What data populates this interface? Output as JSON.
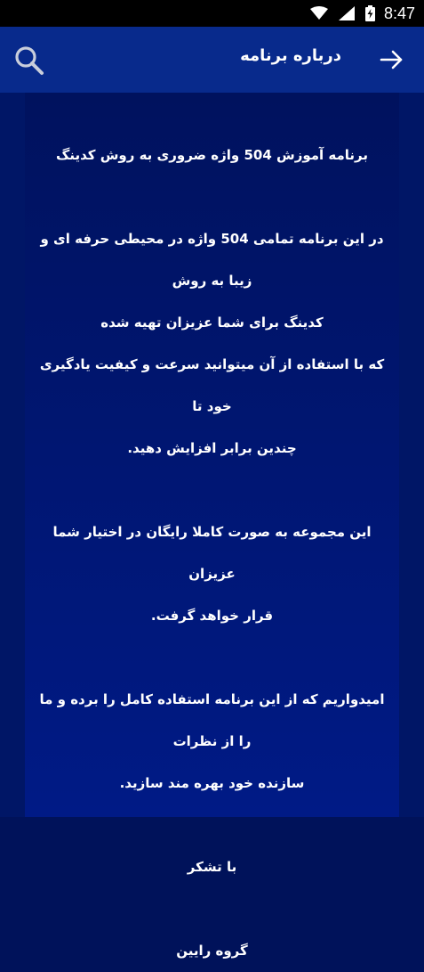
{
  "status_bar": {
    "time": "8:47",
    "icons": [
      "wifi-icon",
      "signal-icon",
      "battery-charging-icon"
    ]
  },
  "app_bar": {
    "title": "درباره برنامه",
    "icons": [
      "search-icon",
      "arrow-right-icon"
    ]
  },
  "about": {
    "heading": "برنامه آموزش 504 واژه ضروری به روش کدینگ",
    "intro_line1": "در این برنامه تمامی 504 واژه در محیطی حرفه ای و زیبا به روش",
    "intro_line2": "کدینگ برای شما عزیزان تهیه شده",
    "intro_line3": "که با استفاده از آن میتوانید سرعت و کیفیت یادگیری خود تا",
    "intro_line4": "چندین برابر افزایش دهید.",
    "free_line1": "این مجموعه به صورت کاملا رایگان در اختیار شما عزیزان",
    "free_line2": "قرار خواهد گرفت.",
    "hope_line1": "امیدواریم که از این برنامه استفاده کامل را برده و ما را از نظرات",
    "hope_line2": "سازنده خود بهره مند سازید.",
    "thanks": "با تشکر",
    "team": "گروه رایین"
  },
  "colors": {
    "status_bar": "#000000",
    "app_bar": "#082a8c",
    "background": "#00125a",
    "text": "#ffffff"
  }
}
